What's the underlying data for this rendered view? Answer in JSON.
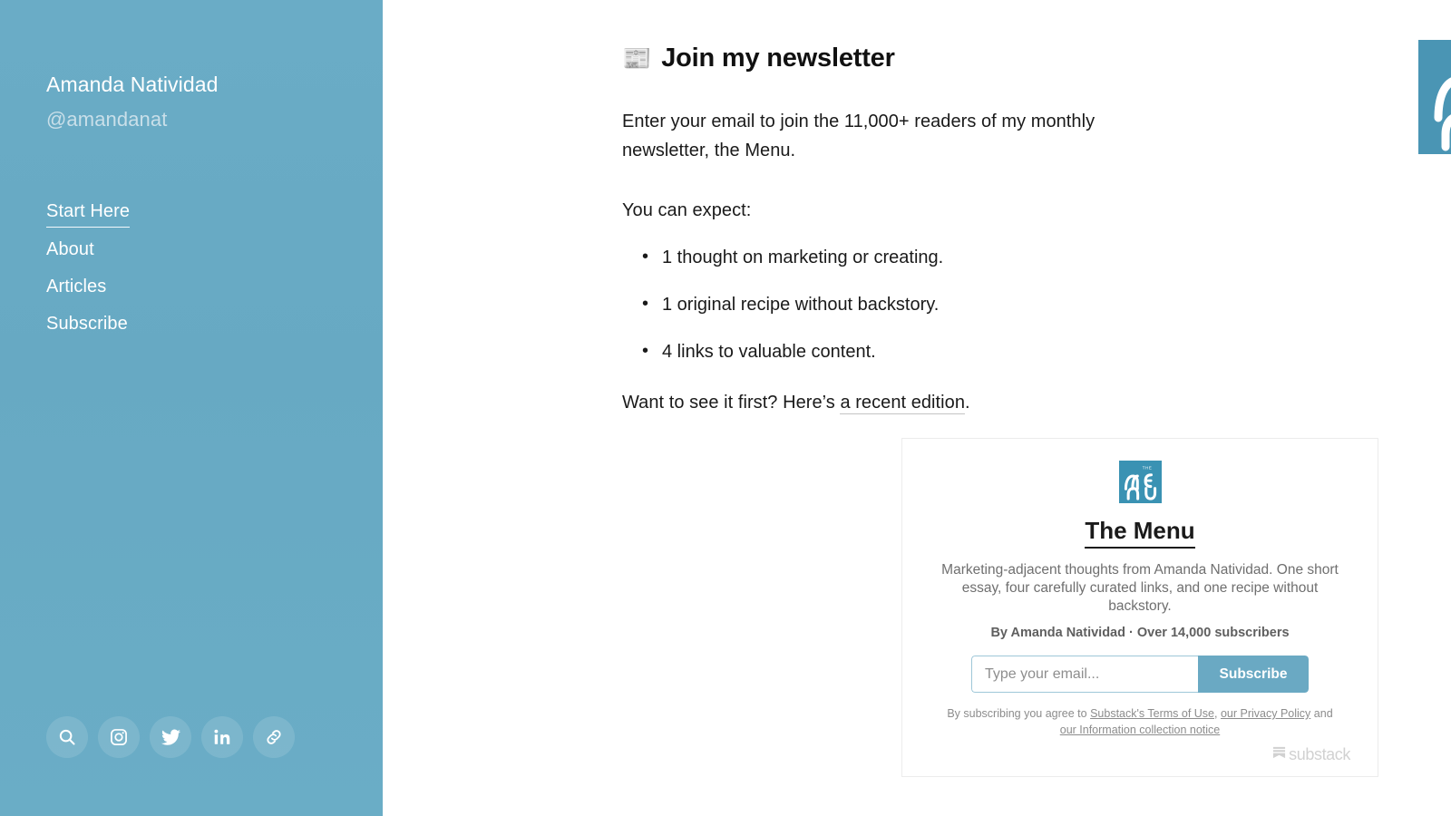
{
  "colors": {
    "sidebar_bg": "#68abc5",
    "brand_teal": "#4a95b4",
    "button_teal": "#6aa9c3",
    "text_dark": "#1a1a1a",
    "muted_grey": "#6f6f6f"
  },
  "sidebar": {
    "author_name": "Amanda Natividad",
    "author_handle": "@amandanat",
    "nav": [
      {
        "label": "Start Here",
        "active": true
      },
      {
        "label": "About",
        "active": false
      },
      {
        "label": "Articles",
        "active": false
      },
      {
        "label": "Subscribe",
        "active": false
      }
    ],
    "socials": [
      {
        "name": "search-icon",
        "title": "Search"
      },
      {
        "name": "instagram-icon",
        "title": "Instagram"
      },
      {
        "name": "twitter-icon",
        "title": "Twitter"
      },
      {
        "name": "linkedin-icon",
        "title": "LinkedIn"
      },
      {
        "name": "link-icon",
        "title": "Link"
      }
    ]
  },
  "main": {
    "emoji": "📰",
    "headline": "Join my newsletter",
    "intro": "Enter your email to join the 11,000+ readers of my monthly newsletter, the Menu.",
    "expect_label": "You can expect:",
    "expect_items": [
      "1 thought on marketing or creating.",
      "1 original recipe without backstory.",
      "4 links to valuable content."
    ],
    "preview_prefix": "Want to see it first? Here’s ",
    "preview_link": "a recent edition",
    "preview_suffix": ".",
    "logo_alt": "THE MENU"
  },
  "embed": {
    "logo_alt": "THE MENU",
    "title": "The Menu",
    "description": "Marketing-adjacent thoughts from Amanda Natividad. One short essay, four carefully curated links, and one recipe without backstory.",
    "byline": "By Amanda Natividad · Over 14,000 subscribers",
    "email_placeholder": "Type your email...",
    "email_value": "",
    "subscribe_label": "Subscribe",
    "legal_prefix": "By subscribing you agree to ",
    "legal_link_terms": "Substack's Terms of Use",
    "legal_sep1": ", ",
    "legal_link_privacy": "our Privacy Policy",
    "legal_sep2": " and ",
    "legal_link_info": "our Information collection notice",
    "powered_by": "substack"
  }
}
